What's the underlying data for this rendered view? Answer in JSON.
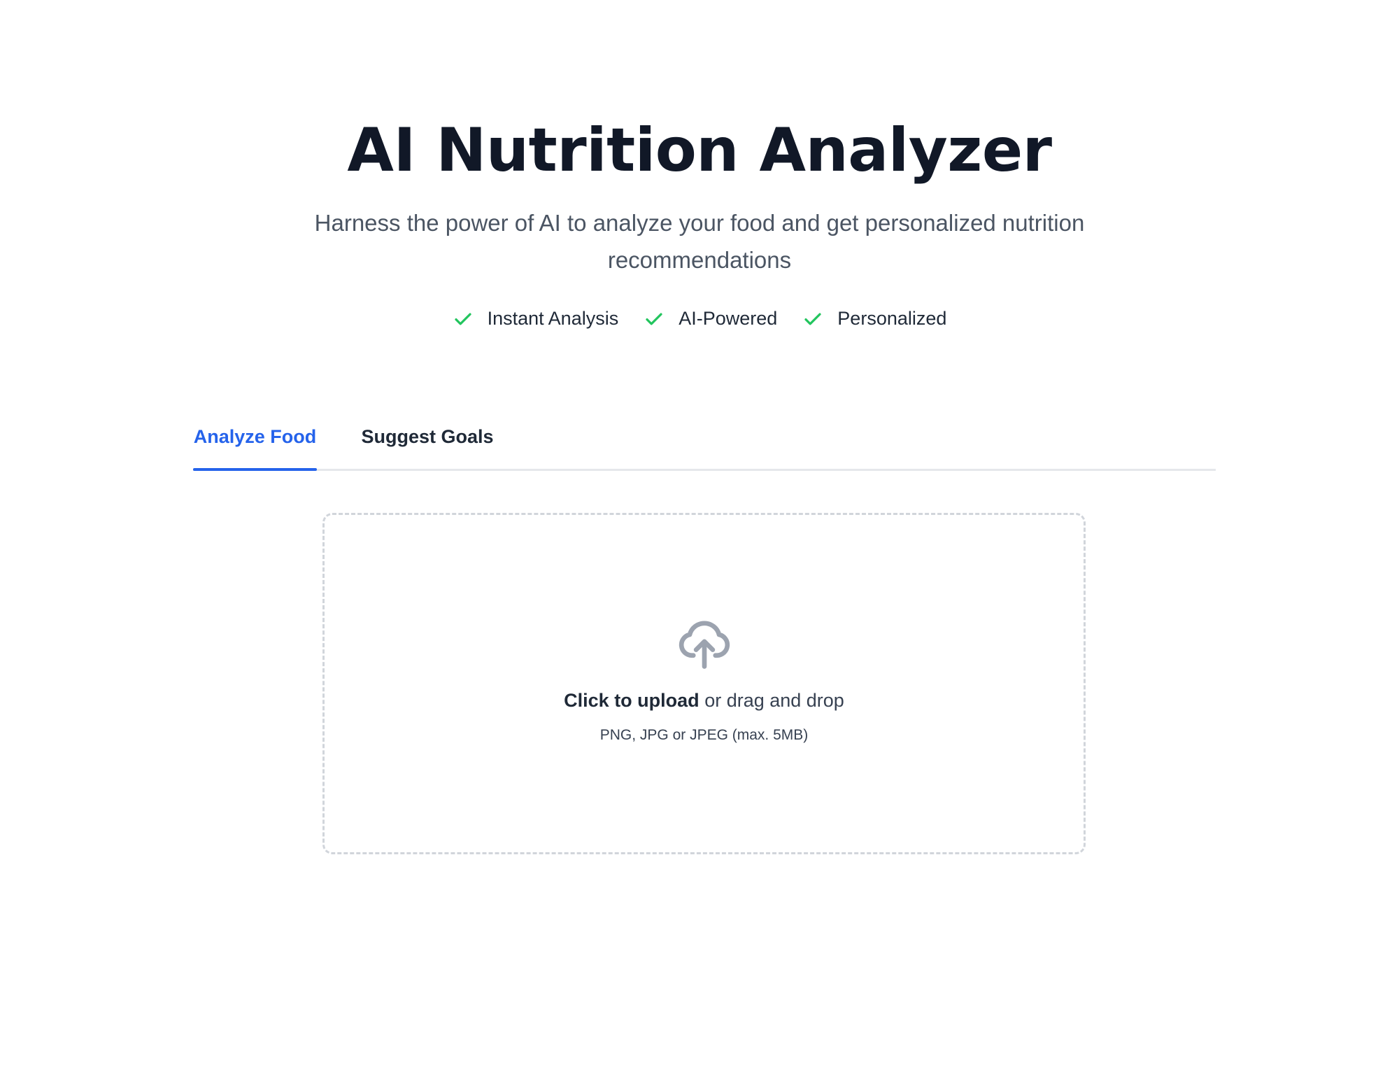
{
  "hero": {
    "title": "AI Nutrition Analyzer",
    "subtitle": "Harness the power of AI to analyze your food and get personalized nutrition recommendations",
    "features": [
      {
        "label": "Instant Analysis",
        "icon": "check-icon"
      },
      {
        "label": "AI-Powered",
        "icon": "check-icon"
      },
      {
        "label": "Personalized",
        "icon": "check-icon"
      }
    ]
  },
  "tabs": [
    {
      "label": "Analyze Food",
      "active": true
    },
    {
      "label": "Suggest Goals",
      "active": false
    }
  ],
  "upload": {
    "icon": "cloud-upload-icon",
    "action_label": "Click to upload",
    "secondary_label": "or drag and drop",
    "hint": "PNG, JPG or JPEG (max. 5MB)"
  },
  "colors": {
    "accent": "#2563eb",
    "check": "#22c55e",
    "title": "#111827",
    "subtitle": "#4b5563",
    "icon_gray": "#9ca3af",
    "border": "#d1d5db"
  }
}
